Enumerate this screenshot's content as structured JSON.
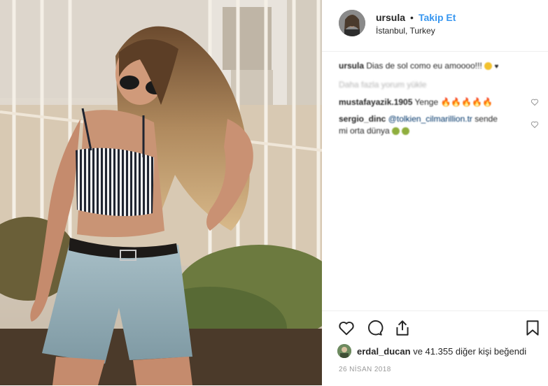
{
  "post": {
    "photo_alt": "Woman in striped crop top and denim shorts in front of a fence",
    "author": {
      "username": "ursula",
      "separator": "•",
      "follow_label": "Takip Et",
      "location": "İstanbul, Turkey"
    },
    "comments": [
      {
        "user": "ursula",
        "text": "Dias de sol como eu amoooo!!!"
      },
      {
        "user": "mustafayazik.1905",
        "text": "Yenge"
      },
      {
        "user": "sergio_dinc",
        "mention": "@tolkien_cilmarillion.tr",
        "text": "sende",
        "text2": "mi orta dünya"
      }
    ],
    "load_more_label": "Daha fazla yorum yükle",
    "likes": {
      "first_user": "erdal_ducan",
      "rest": "ve 41.355 diğer kişi beğendi"
    },
    "date": "26 NİSAN 2018"
  },
  "colors": {
    "accent": "#3897f0",
    "text": "#262626",
    "muted": "#999999"
  },
  "icons": [
    "heart-icon",
    "comment-icon",
    "share-icon",
    "bookmark-icon"
  ]
}
